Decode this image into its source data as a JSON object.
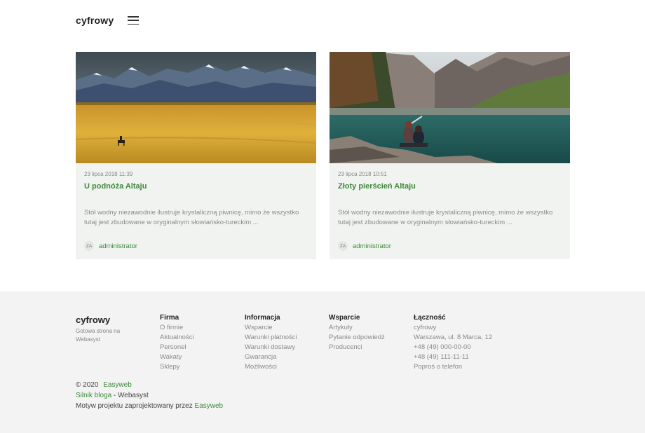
{
  "header": {
    "logo": "cyfrowy"
  },
  "posts": [
    {
      "date": "23 lipca 2018 11:39",
      "title": "U podnóża Altaju",
      "excerpt": "Stół wodny niezawodnie ilustruje krystaliczną piwnicę, mimo że wszystko tutaj jest zbudowane w oryginalnym słowiańsko-tureckim ...",
      "avatar": "ZA",
      "author": "administrator"
    },
    {
      "date": "23 lipca 2018 10:51",
      "title": "Złoty pierścień Altaju",
      "excerpt": "Stół wodny niezawodnie ilustruje krystaliczną piwnicę, mimo że wszystko tutaj jest zbudowane w oryginalnym słowiańsko-tureckim ...",
      "avatar": "ZA",
      "author": "administrator"
    }
  ],
  "footer": {
    "logo": "cyfrowy",
    "tagline": "Gotowa strona na Webasyst",
    "columns": [
      {
        "title": "Firma",
        "items": [
          "O firmie",
          "Aktualności",
          "Personel",
          "Wakaty",
          "Sklepy"
        ]
      },
      {
        "title": "Informacja",
        "items": [
          "Wsparcie",
          "Warunki płatności",
          "Warunki dostawy",
          "Gwarancja",
          "Możliwości"
        ]
      },
      {
        "title": "Wsparcie",
        "items": [
          "Artykuły",
          "Pytanie odpowiedź",
          "Producenci"
        ]
      },
      {
        "title": "Łączność",
        "items": [
          "cyfrowy",
          "Warszawa, ul. 8 Marca, 12",
          "+48 (49) 000-00-00",
          "+48 (49) 111-11-11",
          "Poproś o telefon"
        ]
      }
    ],
    "copyright": "© 2020",
    "copyright_link": "Easyweb",
    "engine_link": "Silnik bloga",
    "engine_suffix": " - Webasyst",
    "theme_text": "Motyw projektu zaprojektowany przez ",
    "theme_link": "Easyweb"
  },
  "colors": {
    "accent": "#3c8a3a",
    "footer_bg": "#f2f3f2",
    "card_bg": "#f1f3f1"
  },
  "icons": {
    "menu": "hamburger-menu-icon"
  }
}
